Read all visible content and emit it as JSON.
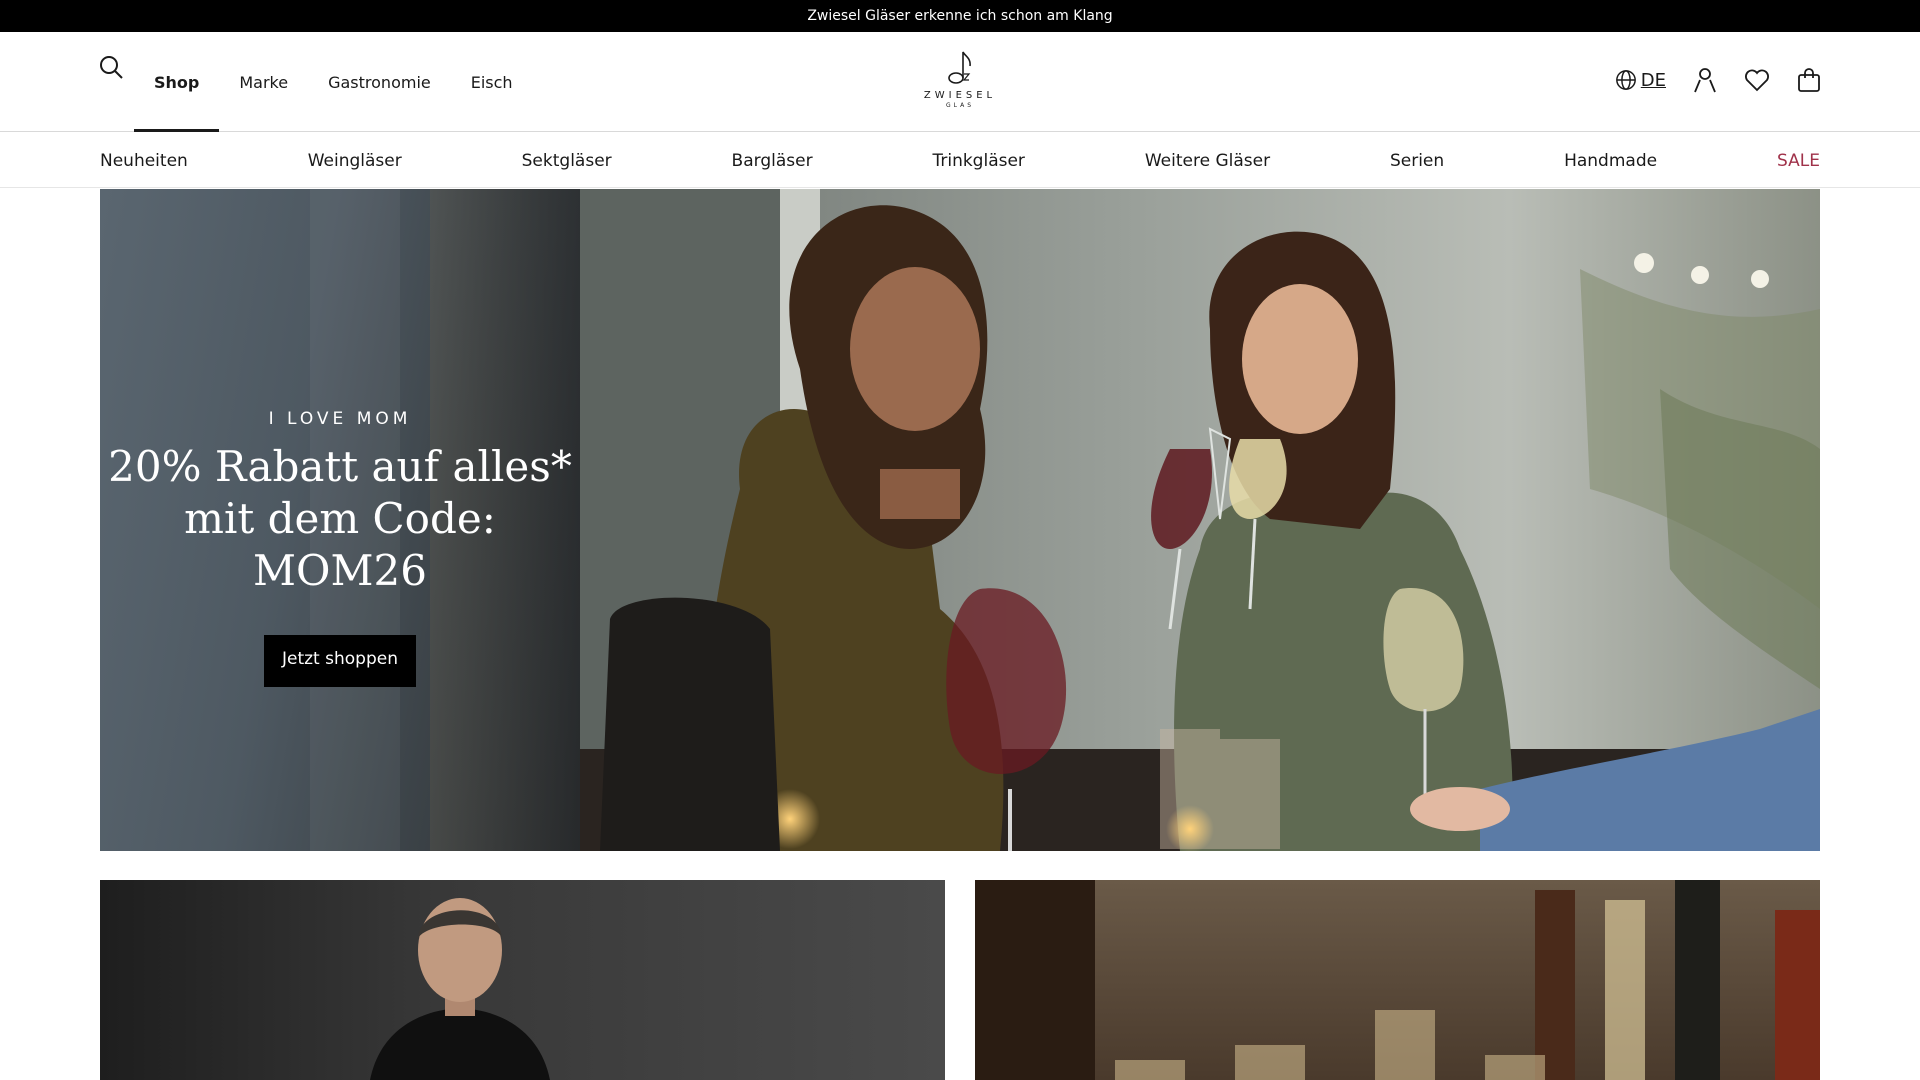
{
  "announcement": {
    "text": "Zwiesel Gläser erkenne ich schon am Klang"
  },
  "header": {
    "nav": [
      {
        "label": "Shop",
        "active": true
      },
      {
        "label": "Marke"
      },
      {
        "label": "Gastronomie"
      },
      {
        "label": "Eisch"
      }
    ],
    "logo": {
      "brand": "ZWIESEL",
      "sub": "GLAS"
    },
    "language": "DE",
    "icons": [
      "search-icon",
      "globe-icon",
      "account-icon",
      "heart-icon",
      "bag-icon"
    ]
  },
  "categories": [
    {
      "label": "Neuheiten"
    },
    {
      "label": "Weingläser"
    },
    {
      "label": "Sektgläser"
    },
    {
      "label": "Bargläser"
    },
    {
      "label": "Trinkgläser"
    },
    {
      "label": "Weitere Gläser"
    },
    {
      "label": "Serien"
    },
    {
      "label": "Handmade"
    },
    {
      "label": "SALE",
      "color": "#a0324a"
    }
  ],
  "hero": {
    "kicker": "I LOVE MOM",
    "headline_line1": "20% Rabatt auf alles*",
    "headline_line2": "mit dem Code: MOM26",
    "cta": "Jetzt shoppen"
  },
  "colors": {
    "accent_sale": "#a0324a",
    "announcement_bg": "#000000"
  }
}
